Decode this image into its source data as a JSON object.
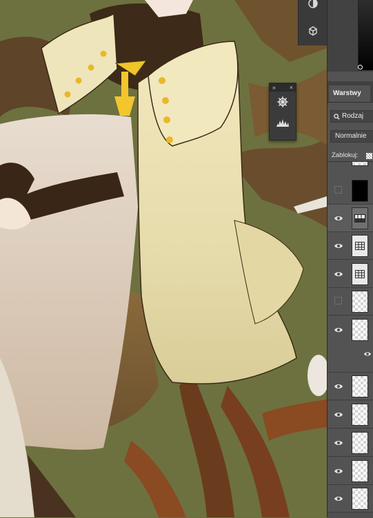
{
  "panel": {
    "tab_label": "Warstwy",
    "filter_label": "Rodzaj",
    "blend_mode": "Normalnie",
    "lock_label": "Zablokuj:"
  },
  "mini_panel": {
    "collapse_glyph": "»",
    "close_glyph": "×",
    "tools": [
      "helm-icon",
      "histogram-icon"
    ]
  },
  "dock_tools": [
    "adjustment-icon",
    "3d-cube-icon"
  ],
  "colors": {
    "canvas_bg": "#6b6f3d",
    "panel_bg": "#535353",
    "cloak": "#ece2b4",
    "tree_brown": "#6b4a2a"
  },
  "layers": [
    {
      "name": "layer-partial-top",
      "visible": null,
      "thumb": "adj"
    },
    {
      "name": "layer-black-fill",
      "visible": false,
      "thumb": "black"
    },
    {
      "name": "layer-gradient-map",
      "visible": true,
      "thumb": "adj-grad",
      "selected": true
    },
    {
      "name": "layer-grid-adjust-1",
      "visible": true,
      "thumb": "adj-grid"
    },
    {
      "name": "layer-grid-adjust-2",
      "visible": true,
      "thumb": "adj-grid"
    },
    {
      "name": "layer-hidden-trans",
      "visible": false,
      "thumb": "trans"
    },
    {
      "name": "layer-with-effect",
      "visible": true,
      "thumb": "trans"
    },
    {
      "name": "layer-trans-1",
      "visible": true,
      "thumb": "trans"
    },
    {
      "name": "layer-trans-2",
      "visible": true,
      "thumb": "trans"
    },
    {
      "name": "layer-trans-3",
      "visible": true,
      "thumb": "trans"
    },
    {
      "name": "layer-trans-4",
      "visible": true,
      "thumb": "trans"
    },
    {
      "name": "layer-trans-5",
      "visible": true,
      "thumb": "trans"
    }
  ]
}
